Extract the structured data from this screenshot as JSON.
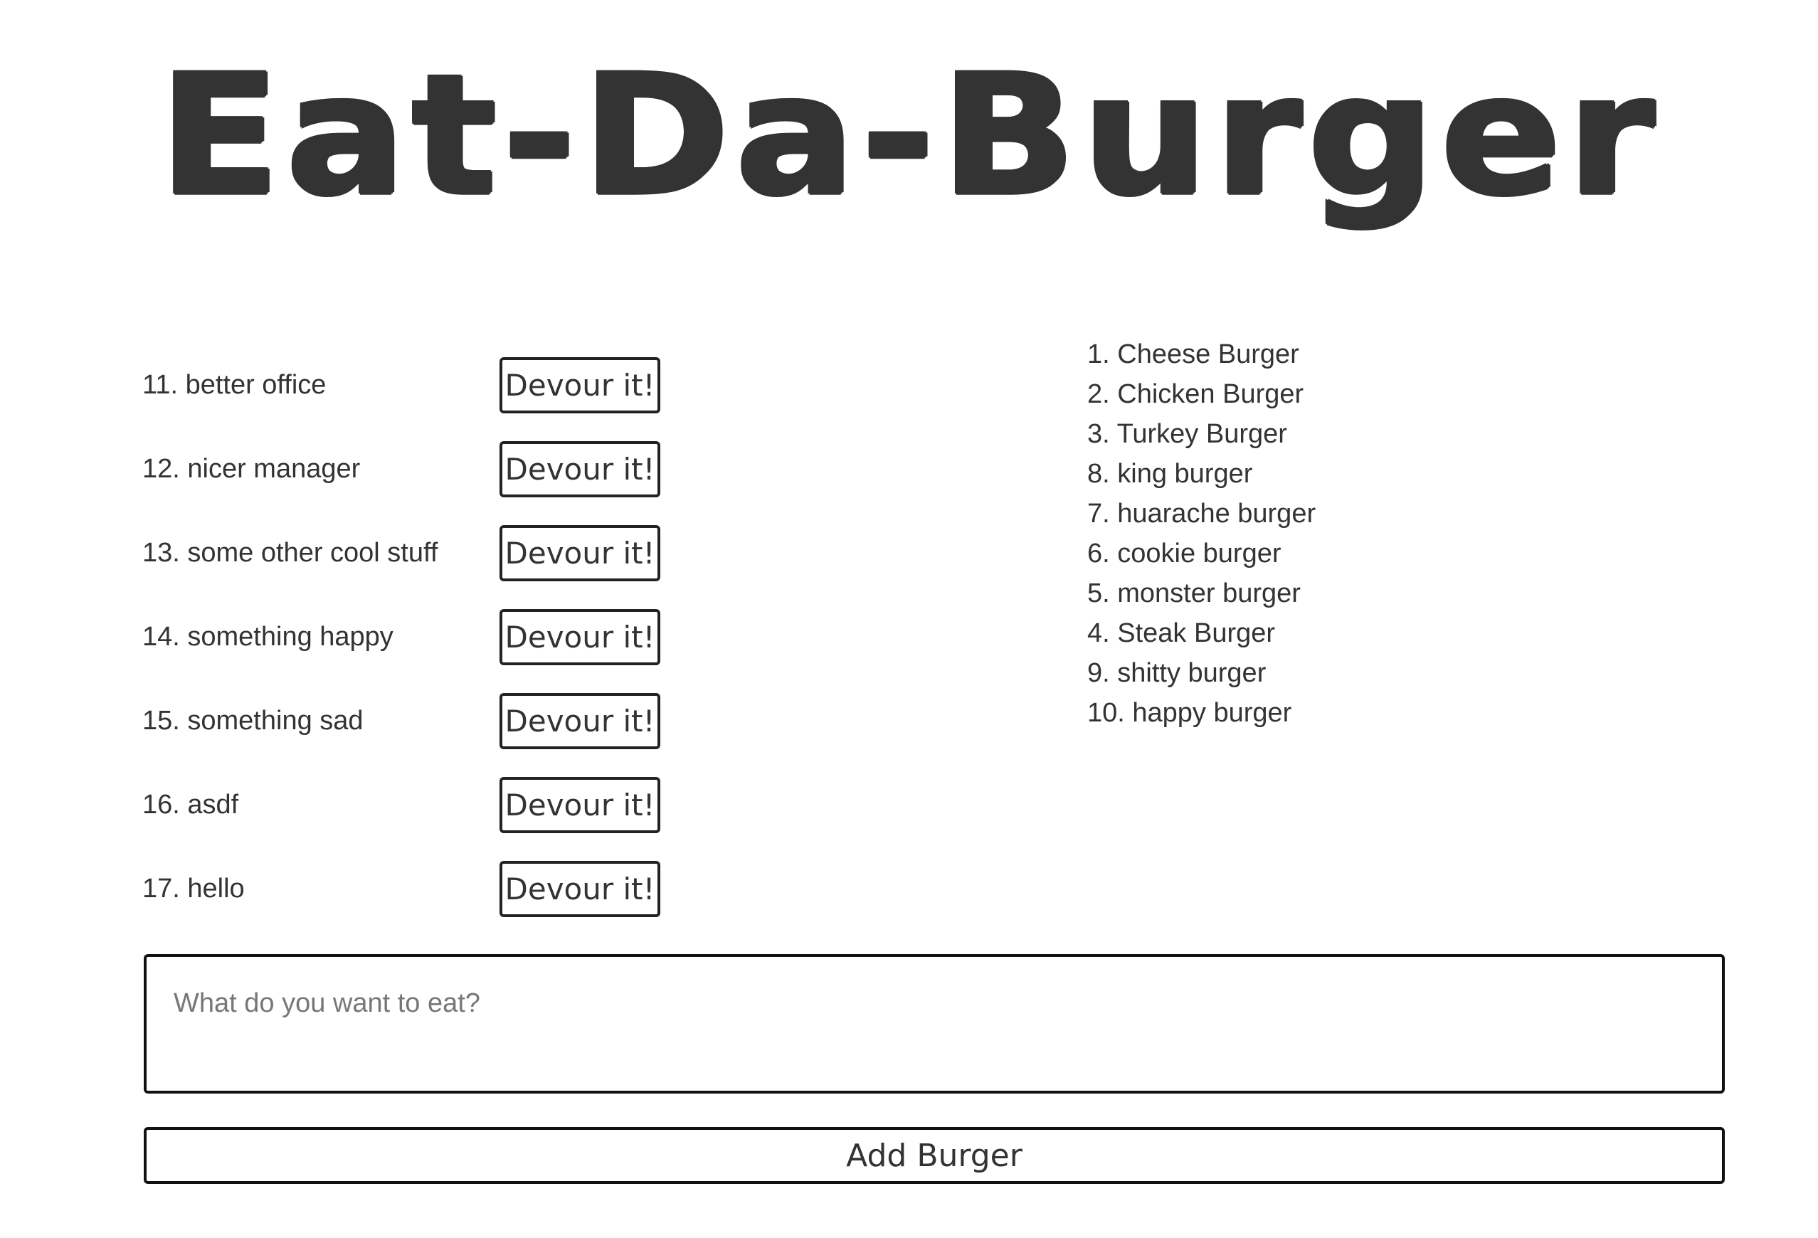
{
  "header": {
    "title": "Eat-Da-Burger"
  },
  "burgers_to_eat": [
    {
      "label": "11. better office",
      "button": "Devour it!"
    },
    {
      "label": "12. nicer manager",
      "button": "Devour it!"
    },
    {
      "label": "13. some other cool stuff",
      "button": "Devour it!"
    },
    {
      "label": "14. something happy",
      "button": "Devour it!"
    },
    {
      "label": "15. something sad",
      "button": "Devour it!"
    },
    {
      "label": "16. asdf",
      "button": "Devour it!"
    },
    {
      "label": "17. hello",
      "button": "Devour it!"
    }
  ],
  "devoured_burgers": [
    "1. Cheese Burger",
    "2. Chicken Burger",
    "3. Turkey Burger",
    "8. king burger",
    "7. huarache burger",
    "6. cookie burger",
    "5. monster burger",
    "4. Steak Burger",
    "9. shitty burger",
    "10. happy burger"
  ],
  "form": {
    "input_value": "",
    "input_placeholder": "What do you want to eat?",
    "submit_label": "Add Burger"
  },
  "colors": {
    "text": "#333333",
    "border": "#111111",
    "background": "#ffffff",
    "placeholder": "#777777"
  }
}
